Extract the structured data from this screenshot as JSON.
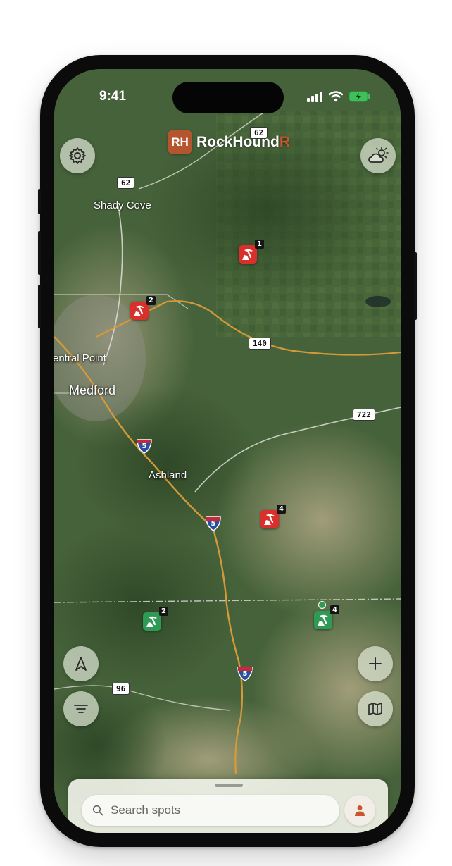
{
  "status_bar": {
    "time": "9:41"
  },
  "brand": {
    "logo_text": "RH",
    "name_main": "RockHound",
    "name_accent": "R"
  },
  "toolbar": {
    "settings": "gear-icon",
    "weather": "partly-sunny-icon",
    "locate": "navigation-arrow-icon",
    "filter": "filter-lines-icon",
    "add": "plus-icon",
    "map_layers": "map-icon"
  },
  "map": {
    "places": {
      "shady_cove": "Shady Cove",
      "central_point": "entral Point",
      "medford": "Medford",
      "ashland": "Ashland"
    },
    "highways": {
      "h62_top": "62",
      "h62": "62",
      "h140": "140",
      "h722": "722",
      "i5_a": "5",
      "i5_b": "5",
      "i5_c": "5",
      "h96": "96"
    },
    "markers": [
      {
        "type": "red",
        "count": "1"
      },
      {
        "type": "red",
        "count": "2"
      },
      {
        "type": "red",
        "count": "4"
      },
      {
        "type": "green",
        "count": "2"
      },
      {
        "type": "green",
        "count": "4"
      }
    ]
  },
  "search": {
    "placeholder": "Search spots"
  },
  "colors": {
    "accent": "#c8552c",
    "marker_red": "#d9302b",
    "marker_green": "#2f9a56",
    "road": "#d49a3a"
  }
}
